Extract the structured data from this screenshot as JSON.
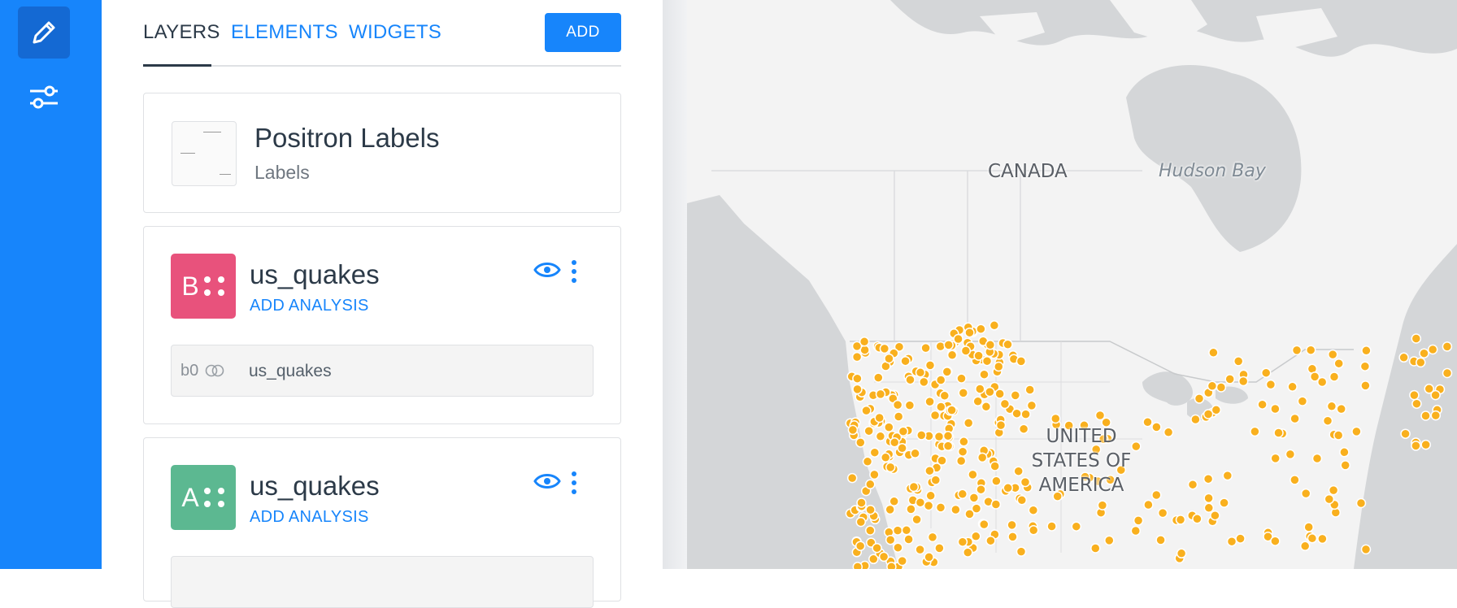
{
  "rail": {
    "items": [
      {
        "icon": "pencil-icon",
        "active": true
      },
      {
        "icon": "sliders-icon",
        "active": false
      }
    ]
  },
  "tabs": {
    "items": [
      {
        "label": "LAYERS",
        "active": true
      },
      {
        "label": "ELEMENTS",
        "active": false
      },
      {
        "label": "WIDGETS",
        "active": false
      }
    ],
    "add_label": "ADD"
  },
  "basemap": {
    "title": "Positron Labels",
    "subtitle": "Labels"
  },
  "layers": [
    {
      "letter": "B",
      "name": "us_quakes",
      "analysis_label": "ADD ANALYSIS",
      "color": "#e8527c",
      "node_id": "b0",
      "node_name": "us_quakes"
    },
    {
      "letter": "A",
      "name": "us_quakes",
      "analysis_label": "ADD ANALYSIS",
      "color": "#5cb891"
    }
  ],
  "map": {
    "labels": {
      "canada": "CANADA",
      "hudson": "Hudson Bay",
      "usa": [
        "UNITED",
        "STATES OF",
        "AMERICA"
      ]
    },
    "point_color": "#f9b01e"
  }
}
